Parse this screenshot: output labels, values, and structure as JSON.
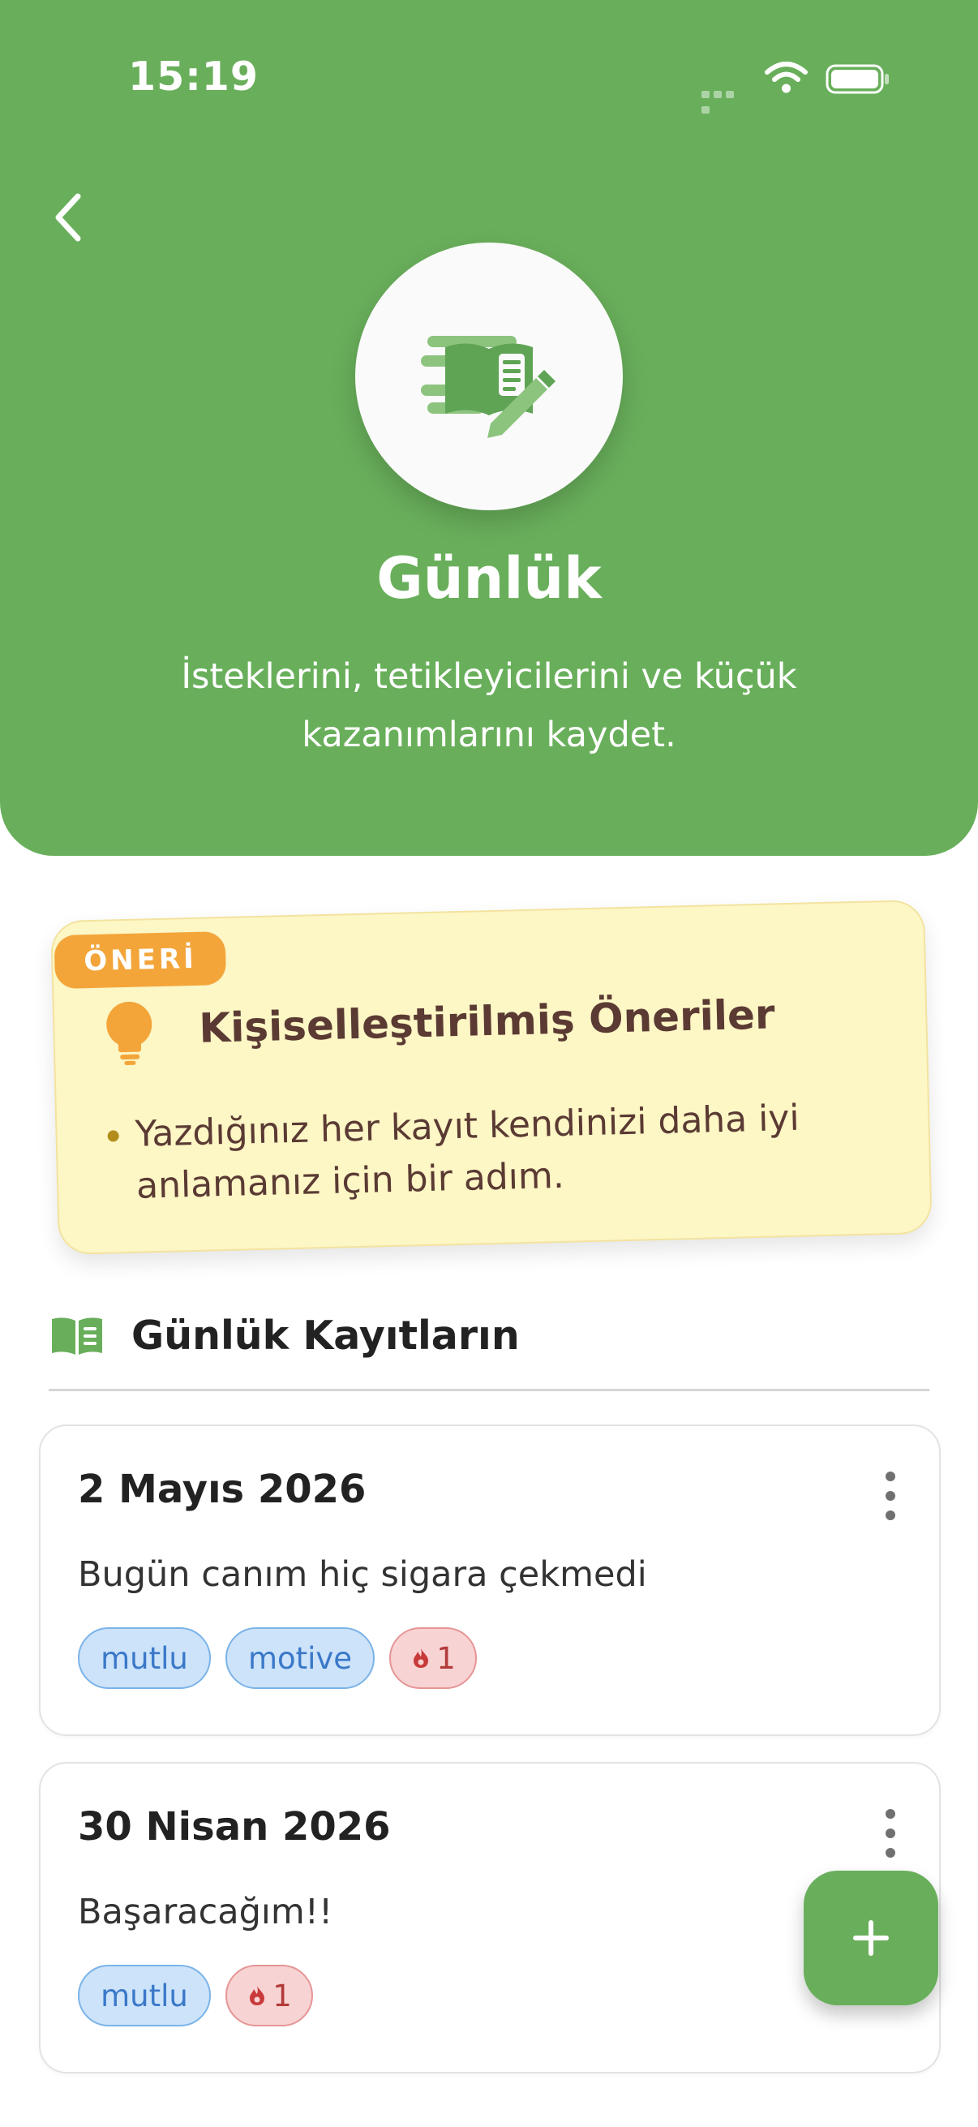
{
  "status_bar": {
    "time": "15:19"
  },
  "colors": {
    "primary": "#69AF5B",
    "suggestion_bg": "#FDF6C5",
    "badge": "#F3A53A",
    "tag_blue": "#3A78C8",
    "tag_red": "#B23A3A"
  },
  "icons": {
    "back": "chevron-left-icon",
    "logo": "journal-writing-icon",
    "suggestion": "lightbulb-icon",
    "section": "open-book-icon",
    "entry_menu": "more-vertical-icon",
    "streak": "flame-icon",
    "add": "plus-icon"
  },
  "header": {
    "title": "Günlük",
    "subtitle": "İsteklerini, tetikleyicilerini ve küçük kazanımlarını kaydet."
  },
  "suggestion": {
    "badge": "ÖNERİ",
    "title": "Kişiselleştirilmiş Öneriler",
    "items": [
      "Yazdığınız her kayıt kendinizi daha iyi anlamanız için bir adım."
    ]
  },
  "section": {
    "title": "Günlük Kayıtların"
  },
  "entries": [
    {
      "date": "2 Mayıs 2026",
      "text": "Bugün canım hiç sigara çekmedi",
      "tags": [
        "mutlu",
        "motive"
      ],
      "craving_count": "1"
    },
    {
      "date": "30 Nisan 2026",
      "text": "Başaracağım!!",
      "tags": [
        "mutlu"
      ],
      "craving_count": "1"
    }
  ]
}
